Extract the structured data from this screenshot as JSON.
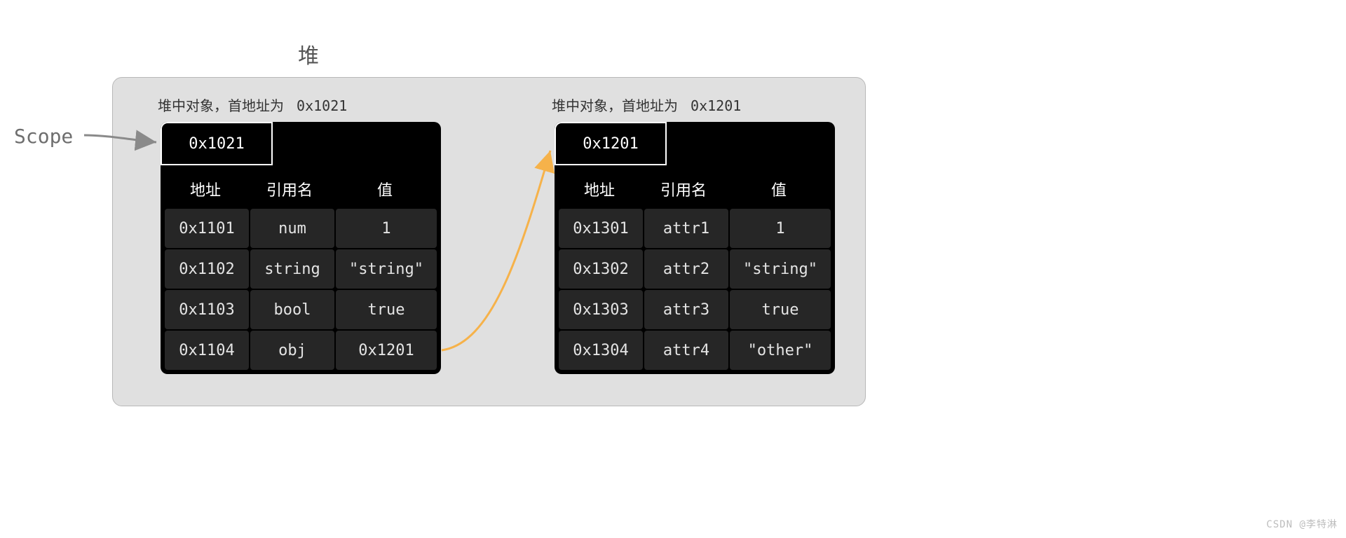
{
  "diagram": {
    "heap_title": "堆",
    "scope_label": "Scope",
    "watermark": "CSDN @李特淋",
    "columns": {
      "addr": "地址",
      "name": "引用名",
      "value": "值"
    },
    "blockA": {
      "caption_prefix": "堆中对象，首地址为",
      "caption_addr": "0x1021",
      "start_addr": "0x1021",
      "rows": [
        {
          "addr": "0x1101",
          "name": "num",
          "value": "1"
        },
        {
          "addr": "0x1102",
          "name": "string",
          "value": "\"string\""
        },
        {
          "addr": "0x1103",
          "name": "bool",
          "value": "true"
        },
        {
          "addr": "0x1104",
          "name": "obj",
          "value": "0x1201"
        }
      ]
    },
    "blockB": {
      "caption_prefix": "堆中对象，首地址为",
      "caption_addr": "0x1201",
      "start_addr": "0x1201",
      "rows": [
        {
          "addr": "0x1301",
          "name": "attr1",
          "value": "1"
        },
        {
          "addr": "0x1302",
          "name": "attr2",
          "value": "\"string\""
        },
        {
          "addr": "0x1303",
          "name": "attr3",
          "value": "true"
        },
        {
          "addr": "0x1304",
          "name": "attr4",
          "value": "\"other\""
        }
      ]
    },
    "pointer": {
      "from_row": 3,
      "to_block": "B"
    }
  }
}
